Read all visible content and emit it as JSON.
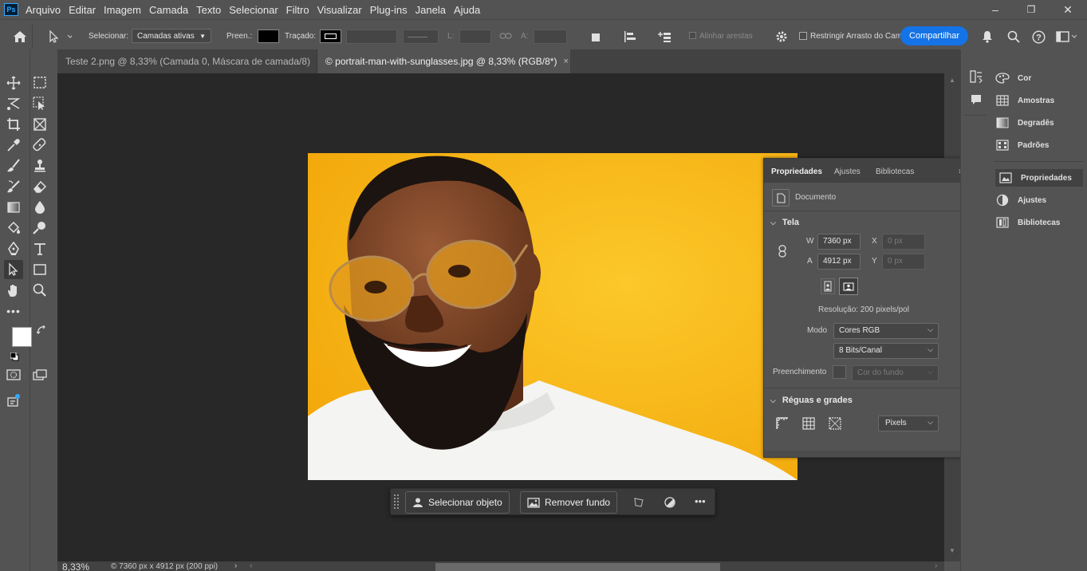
{
  "app": {
    "logo": "Ps"
  },
  "menu": [
    "Arquivo",
    "Editar",
    "Imagem",
    "Camada",
    "Texto",
    "Selecionar",
    "Filtro",
    "Visualizar",
    "Plug-ins",
    "Janela",
    "Ajuda"
  ],
  "window_controls": {
    "minimize": "–",
    "restore": "❐",
    "close": "✕"
  },
  "options": {
    "select_label": "Selecionar:",
    "select_value": "Camadas ativas",
    "fill_label": "Preen.:",
    "stroke_label": "Traçado:",
    "width_label": "L:",
    "height_label": "A:",
    "align_edges": "Alinhar arestas",
    "constrain_path": "Restringir Arrasto do Cam",
    "share": "Compartilhar"
  },
  "tabs": [
    {
      "label": "Teste 2.png @ 8,33% (Camada 0, Máscara de camada/8)",
      "active": false
    },
    {
      "label": "© portrait-man-with-sunglasses.jpg @ 8,33% (RGB/8*)",
      "active": true
    }
  ],
  "tab_close": "×",
  "properties": {
    "tabs": [
      "Propriedades",
      "Ajustes",
      "Bibliotecas"
    ],
    "doc_label": "Documento",
    "canvas_section": "Tela",
    "w_label": "W",
    "w_value": "7360 px",
    "x_label": "X",
    "x_value": "0 px",
    "h_label": "A",
    "h_value": "4912 px",
    "y_label": "Y",
    "y_value": "0 px",
    "resolution": "Resolução: 200 pixels/pol",
    "mode_label": "Modo",
    "mode_value": "Cores RGB",
    "bits_value": "8 Bits/Canal",
    "fill_label": "Preenchimento",
    "fill_value": "Cor do fundo",
    "rulers_section": "Réguas e grades",
    "units_value": "Pixels"
  },
  "right_dock": [
    "Cor",
    "Amostras",
    "Degradês",
    "Padrões",
    "Propriedades",
    "Ajustes",
    "Bibliotecas"
  ],
  "context_bar": {
    "select_subject": "Selecionar objeto",
    "remove_bg": "Remover fundo",
    "more": "•••"
  },
  "status": {
    "zoom": "8,33%",
    "doc_info": "© 7360 px x 4912 px (200 ppi)"
  },
  "colors": {
    "accent": "#1473e6",
    "photo_bg": "#f6b40c"
  }
}
